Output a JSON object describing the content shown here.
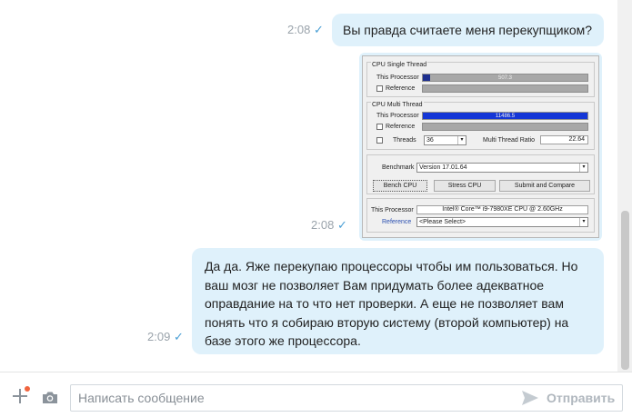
{
  "messages": [
    {
      "time": "2:08",
      "text": "Вы правда считаете меня перекупщиком?"
    },
    {
      "time": "2:08",
      "attachment": {
        "cpu_single": {
          "title": "CPU Single Thread",
          "this_label": "This Processor",
          "this_value": "507.3",
          "this_fraction": 0.045,
          "ref_label": "Reference"
        },
        "cpu_multi": {
          "title": "CPU Multi Thread",
          "this_label": "This Processor",
          "this_value": "11486.5",
          "this_fraction": 1.0,
          "ref_label": "Reference",
          "threads_label": "Threads",
          "threads_value": "36",
          "ratio_label": "Multi Thread Ratio",
          "ratio_value": "22.64"
        },
        "benchmark": {
          "label": "Benchmark",
          "version": "Version 17.01.64",
          "bench_btn": "Bench CPU",
          "stress_btn": "Stress CPU",
          "submit_btn": "Submit and Compare"
        },
        "info": {
          "this_label": "This Processor",
          "this_value": "Intel® Core™ i9-7980XE CPU @ 2.60GHz",
          "ref_label": "Reference",
          "ref_value": "<Please Select>"
        }
      }
    },
    {
      "time": "2:09",
      "lines": [
        "Да да. Яже перекупаю процессоры чтобы им пользоваться. Но",
        "ваш мозг не позволяет Вам придумать более адекватное",
        "оправдание на то что нет проверки. А еще не позволяет вам",
        "понять что я собираю вторую систему (второй компьютер) на",
        "базе этого же процессора."
      ]
    }
  ],
  "composer": {
    "placeholder": "Написать сообщение",
    "send_label": "Отправить"
  },
  "colors": {
    "bubble": "#dff1fb",
    "check": "#4a9fd5",
    "bar_single": "#1d2f8f",
    "bar_multi": "#1436d6"
  },
  "icons": [
    "plus-icon",
    "camera-icon",
    "send-icon",
    "check-icon"
  ]
}
